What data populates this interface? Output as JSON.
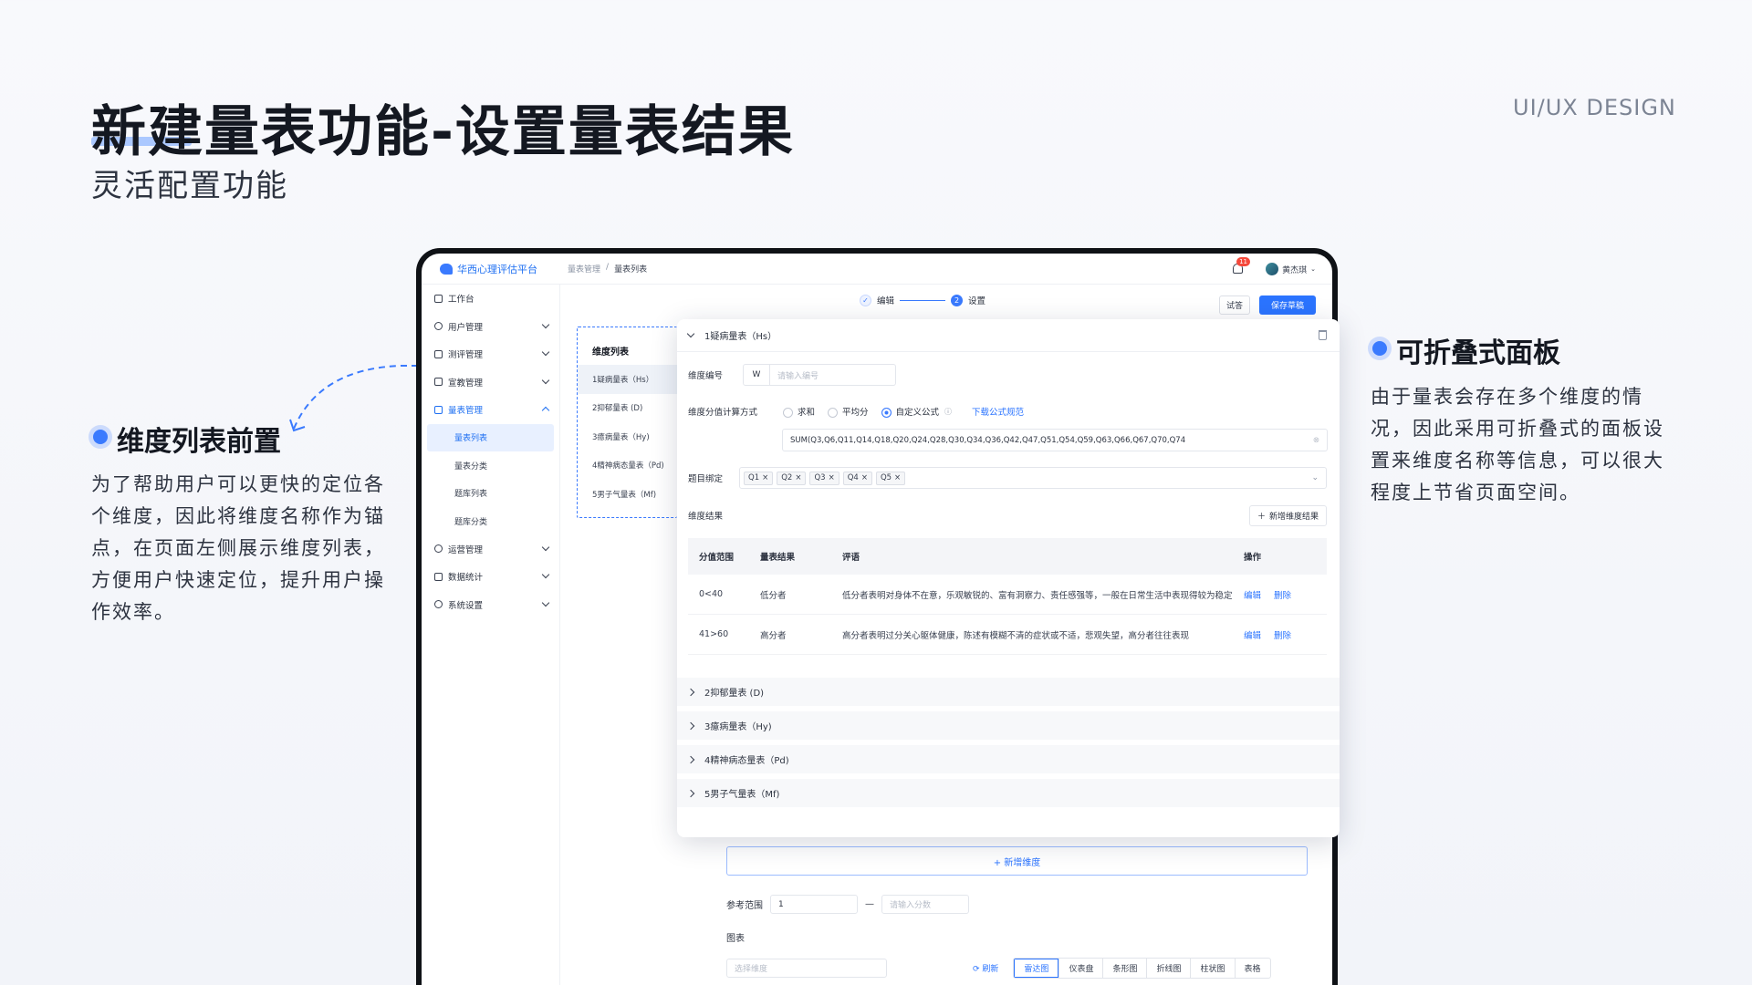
{
  "hero": {
    "title": "新建量表功能-设置量表结果",
    "subtitle": "灵活配置功能",
    "tag": "UI/UX DESIGN"
  },
  "annotations": {
    "left": {
      "heading": "维度列表前置",
      "body": "为了帮助用户可以更快的定位各个维度，因此将维度名称作为锚点，在页面左侧展示维度列表，方便用户快速定位，提升用户操作效率。"
    },
    "right": {
      "heading": "可折叠式面板",
      "body": "由于量表会存在多个维度的情况，因此采用可折叠式的面板设置来维度名称等信息，可以很大程度上节省页面空间。"
    }
  },
  "app": {
    "logo_text": "华西心理评估平台",
    "breadcrumb": [
      "量表管理",
      "/",
      "量表列表"
    ],
    "notification_count": "11",
    "user_name": "黄杰琪",
    "sidebar": [
      {
        "label": "工作台",
        "icon": "monitor-icon",
        "expandable": false
      },
      {
        "label": "用户管理",
        "icon": "user-icon",
        "expandable": true
      },
      {
        "label": "测评管理",
        "icon": "clipboard-icon",
        "expandable": true
      },
      {
        "label": "宣教管理",
        "icon": "book-icon",
        "expandable": true
      },
      {
        "label": "量表管理",
        "icon": "list-icon",
        "expandable": true,
        "selected": true,
        "children": [
          {
            "label": "量表列表",
            "active": true
          },
          {
            "label": "量表分类"
          },
          {
            "label": "题库列表"
          },
          {
            "label": "题库分类"
          }
        ]
      },
      {
        "label": "运营管理",
        "icon": "settings-icon",
        "expandable": true
      },
      {
        "label": "数据统计",
        "icon": "chart-icon",
        "expandable": true
      },
      {
        "label": "系统设置",
        "icon": "gear-icon",
        "expandable": true
      }
    ],
    "steps": [
      {
        "label": "编辑",
        "state": "done",
        "mark": "✓"
      },
      {
        "label": "设置",
        "state": "current",
        "mark": "2"
      }
    ],
    "buttons": {
      "trial": "试答",
      "save_draft": "保存草稿"
    },
    "dimension_list": {
      "title": "维度列表",
      "items": [
        "1疑病量表（Hs）",
        "2抑郁量表 (D)",
        "3癔病量表（Hy)",
        "4精神病态量表（Pd)",
        "5男子气量表（Mf)"
      ]
    },
    "panel": {
      "title": "1疑病量表（Hs）",
      "dimension_code_label": "维度编号",
      "dimension_code_prefix": "W",
      "dimension_code_placeholder": "请输入编号",
      "calc_label": "维度分值计算方式",
      "calc_options": [
        "求和",
        "平均分",
        "自定义公式"
      ],
      "calc_selected": "自定义公式",
      "formula_link": "下载公式规范",
      "formula": "SUM(Q3,Q6,Q11,Q14,Q18,Q20,Q24,Q28,Q30,Q34,Q36,Q42,Q47,Q51,Q54,Q59,Q63,Q66,Q67,Q70,Q74",
      "binding_label": "题目绑定",
      "binding_chips": [
        "Q1",
        "Q2",
        "Q3",
        "Q4",
        "Q5"
      ],
      "result_label": "维度结果",
      "add_result_button": "新增维度结果",
      "table": {
        "headers": [
          "分值范围",
          "量表结果",
          "评语",
          "操作"
        ],
        "rows": [
          {
            "range": "0<40",
            "result": "低分者",
            "comment": "低分者表明对身体不在意，乐观敏锐的、富有洞察力、责任感强等，一般在日常生活中表现得较为稳定",
            "edit": "编辑",
            "delete": "删除"
          },
          {
            "range": "41>60",
            "result": "高分者",
            "comment": "高分者表明过分关心躯体健康，陈述有模糊不清的症状或不适，悲观失望，高分者往往表现",
            "edit": "编辑",
            "delete": "删除"
          }
        ]
      }
    },
    "collapsed_panels": [
      "2抑郁量表 (D)",
      "3癔病量表（Hy)",
      "4精神病态量表（Pd)",
      "5男子气量表（Mf)"
    ],
    "add_dimension": "+ 新增维度",
    "ref_range_label": "参考范围",
    "ref_range_value": "1",
    "ref_range_dash": "—",
    "ref_range_placeholder": "请输入分数",
    "chart_label": "图表",
    "chart_select_placeholder": "选择维度",
    "refresh_label": "刷新",
    "chart_types": [
      "雷达图",
      "仪表盘",
      "条形图",
      "折线图",
      "柱状图",
      "表格"
    ],
    "chart_type_selected": "雷达图"
  },
  "colors": {
    "accent": "#3a7afe",
    "link": "#2b74ff",
    "badge": "#f5483b"
  }
}
